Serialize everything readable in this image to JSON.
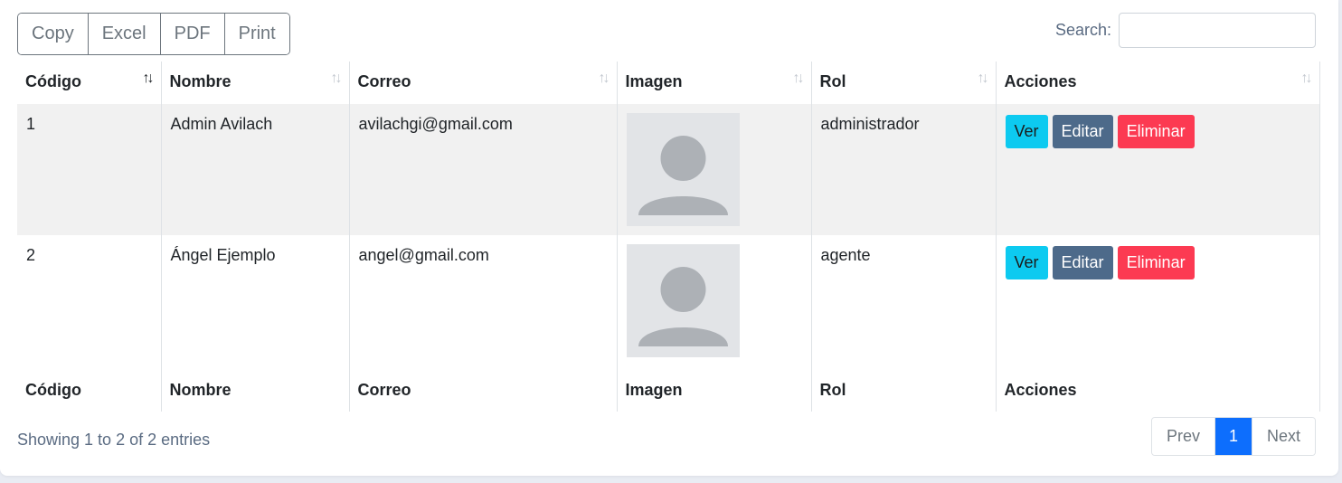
{
  "export_buttons": [
    "Copy",
    "Excel",
    "PDF",
    "Print"
  ],
  "search": {
    "label": "Search:",
    "value": ""
  },
  "columns": [
    "Código",
    "Nombre",
    "Correo",
    "Imagen",
    "Rol",
    "Acciones"
  ],
  "sort": {
    "active_column": "Código",
    "direction": "ascending"
  },
  "rows": [
    {
      "codigo": "1",
      "nombre": "Admin Avilach",
      "correo": "avilachgi@gmail.com",
      "imagen": "avatar-placeholder",
      "rol": "administrador"
    },
    {
      "codigo": "2",
      "nombre": "Ángel Ejemplo",
      "correo": "angel@gmail.com",
      "imagen": "avatar-placeholder",
      "rol": "agente"
    }
  ],
  "actions": {
    "ver": "Ver",
    "editar": "Editar",
    "eliminar": "Eliminar"
  },
  "footer_columns": [
    "Código",
    "Nombre",
    "Correo",
    "Imagen",
    "Rol",
    "Acciones"
  ],
  "info": "Showing 1 to 2 of 2 entries",
  "pagination": {
    "prev": "Prev",
    "current": "1",
    "next": "Next"
  },
  "colors": {
    "ver": "#0dcaf0",
    "editar": "#4d6a8a",
    "eliminar": "#fc3a52",
    "page_active": "#0d6efd",
    "avatar_bg": "#e2e4e7",
    "avatar_fg": "#adb1b6"
  }
}
